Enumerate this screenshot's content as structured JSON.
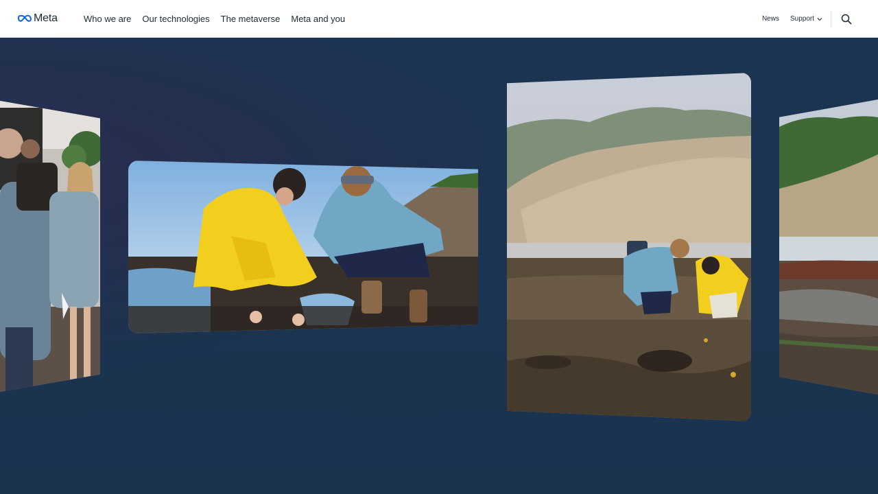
{
  "nav": {
    "logo_text": "Meta",
    "links": [
      "Who we are",
      "Our technologies",
      "The metaverse",
      "Meta and you"
    ],
    "news": "News",
    "support": "Support"
  },
  "icons": {
    "logo": "meta-infinity-logo-icon",
    "support_chevron": "chevron-down-icon",
    "search": "search-icon"
  },
  "colors": {
    "text": "#1c2b33",
    "brand_blue": "#0668e1",
    "hero_background": "#1a3350",
    "jacket_yellow": "#f2cf1f",
    "jacket_blue": "#6fa7c4"
  }
}
